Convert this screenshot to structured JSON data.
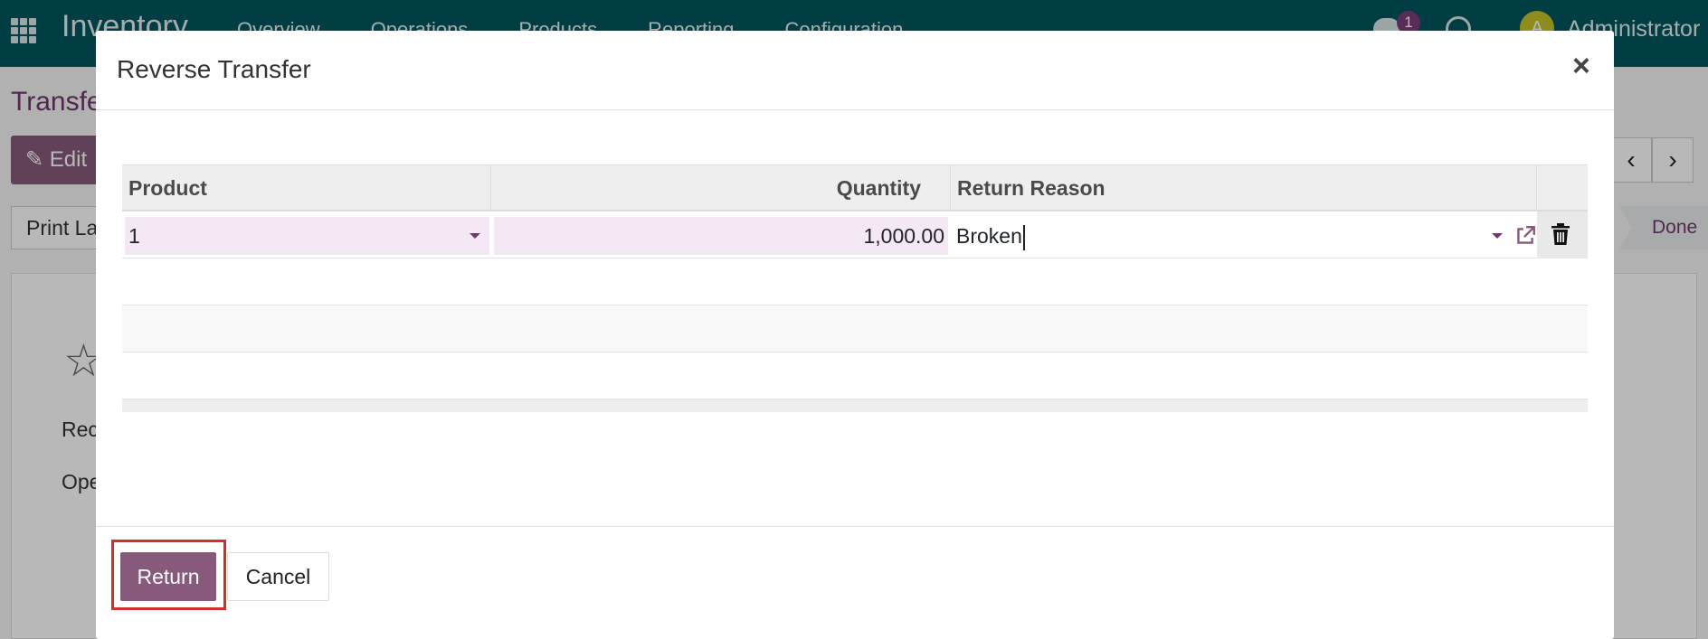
{
  "navbar": {
    "brand": "Inventory",
    "menu": [
      "Overview",
      "Operations",
      "Products",
      "Reporting",
      "Configuration"
    ],
    "message_count": "1",
    "avatar_initial": "A",
    "user_name": "Administrator"
  },
  "background": {
    "breadcrumb": "Transfe",
    "edit_label": "Edit",
    "print_label": "Print La",
    "status_stage": "Done",
    "field_label_1": "Rec",
    "field_label_2": "Ope"
  },
  "dialog": {
    "title": "Reverse Transfer",
    "close_symbol": "×",
    "columns": {
      "product": "Product",
      "quantity": "Quantity",
      "return_reason": "Return Reason"
    },
    "line": {
      "product": "1",
      "quantity": "1,000.00",
      "return_reason": "Broken"
    },
    "return_label": "Return",
    "cancel_label": "Cancel"
  },
  "colors": {
    "navbar": "#00565f",
    "primary": "#875a7b",
    "editable_cell": "#f4e8f4",
    "highlight": "#d32f2f"
  }
}
